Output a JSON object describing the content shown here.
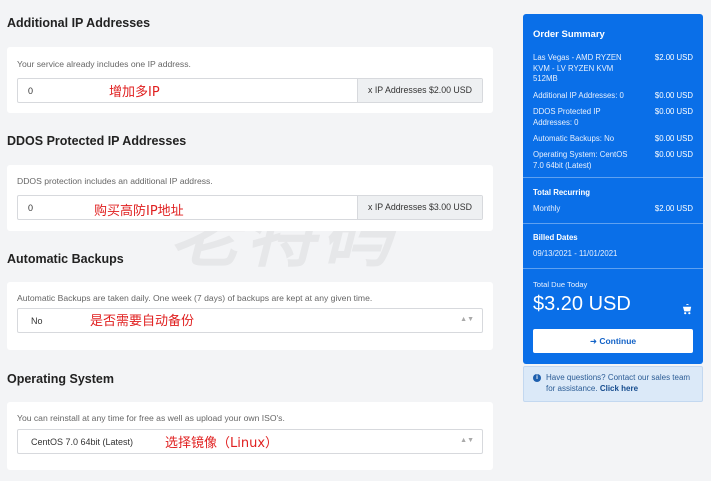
{
  "sections": {
    "additional_ip": {
      "title": "Additional IP Addresses",
      "desc": "Your service already includes one IP address.",
      "value": "0",
      "addon": "x IP Addresses $2.00 USD",
      "annotation": "增加多IP"
    },
    "ddos_ip": {
      "title": "DDOS Protected IP Addresses",
      "desc": "DDOS protection includes an additional IP address.",
      "value": "0",
      "addon": "x IP Addresses $3.00 USD",
      "annotation": "购买高防IP地址"
    },
    "backups": {
      "title": "Automatic Backups",
      "desc": "Automatic Backups are taken daily. One week (7 days) of backups are kept at any given time.",
      "value": "No",
      "annotation": "是否需要自动备份"
    },
    "os": {
      "title": "Operating System",
      "desc": "You can reinstall at any time for free as well as upload your own ISO's.",
      "value": "CentOS 7.0 64bit (Latest)",
      "annotation": "选择镜像（Linux）"
    }
  },
  "watermark": "老特码",
  "summary": {
    "title": "Order Summary",
    "items": [
      {
        "label": "Las Vegas - AMD RYZEN KVM - LV RYZEN KVM 512MB",
        "amount": "$2.00 USD"
      },
      {
        "label": "Additional IP Addresses: 0",
        "amount": "$0.00 USD"
      },
      {
        "label": "DDOS Protected IP Addresses: 0",
        "amount": "$0.00 USD"
      },
      {
        "label": "Automatic Backups: No",
        "amount": "$0.00 USD"
      },
      {
        "label": "Operating System: CentOS 7.0 64bit (Latest)",
        "amount": "$0.00 USD"
      }
    ],
    "recurring_title": "Total Recurring",
    "recurring_label": "Monthly",
    "recurring_amount": "$2.00 USD",
    "billed_title": "Billed Dates",
    "billed_range": "09/13/2021 - 11/01/2021",
    "total_label": "Total Due Today",
    "total": "$3.20 USD",
    "continue_label": "Continue"
  },
  "help": {
    "text": "Have questions? Contact our sales team for assistance.",
    "link": "Click here"
  },
  "colors": {
    "summary_bg": "#0a6fe8",
    "annotation": "#e02020"
  }
}
